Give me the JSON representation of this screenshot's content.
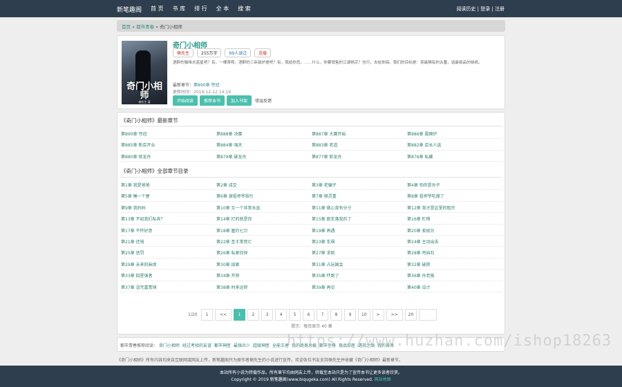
{
  "header": {
    "logo": "新笔趣阁",
    "nav": [
      "首 页",
      "书 库",
      "排 行",
      "全 本",
      "搜 索"
    ],
    "user": "阅读历史 | 登录 | 注册"
  },
  "breadcrumb": {
    "home": "首页",
    "category": "都市青春",
    "current": "奇门小相师",
    "sep": "»"
  },
  "book": {
    "title": "奇门小相师",
    "author": "楠先生",
    "words": "255万字",
    "readers": "69人读过",
    "status": "连载",
    "cover_title": "奇门小相师",
    "cover_sub": "楠先生 著",
    "intro": "酒醉的猫咪水蓝星吧？有，一棵茶呢。酒醉的三卧敌炉是吧？有，我给你您。……什么，你要销售的江湖杨宗？也行，去给你搞。我们的目标是：卖最稀有的古董，追最极品的妹纸。",
    "latest_label": "最新章节：",
    "latest_chapter": "第890章 夺冠",
    "updated_label": "更新时间：",
    "updated": "2019-12-12 14:19",
    "buttons": [
      "开始阅读",
      "推荐本书",
      "加入书架"
    ],
    "feedback": "错误反馈"
  },
  "latest": {
    "title": "《奇门小相师》最新章节",
    "chapters": [
      "第890章 夺冠",
      "第888章 决赛",
      "第887章 大赛开始",
      "第886章 震狮炉",
      "第885章 新店开业",
      "第884章 强天",
      "第883章 老道",
      "第882章 店长人选",
      "第880章 修龙舟",
      "第879章 破龙舟",
      "第877章 斩龙舟",
      "第876章 私藏"
    ]
  },
  "catalog": {
    "title": "《奇门小相师》全部章节目录",
    "chapters": [
      "第1章 我是爸爸",
      "第2章 成交",
      "第3章 老骗子",
      "第4章 怕你是孙子",
      "第5章 睡一个屋",
      "第6章 谢祖师爷指引",
      "第7章 够灵重",
      "第8章 祖师爷吃撑了",
      "第9章 我妈妈",
      "第10章 又一个非常水盆",
      "第11章 做心我有分寸",
      "第12章 我才是这里的租宗",
      "第13章 不如我们私奔？",
      "第14章 打的就是你",
      "第15章 跑车落我的了",
      "第16章 盯梢",
      "第17章 不怀好意",
      "第18章 匿约七贝",
      "第19章 再遇",
      "第20章 卖砚台",
      "第21章 还钱",
      "第22章 圣王常死亡",
      "第23章 车祸",
      "第24章 主动出击",
      "第25章 惩罚",
      "第26章 私家侦探",
      "第27章 求助",
      "第28章 鸡血石",
      "第29章 未来的麻烦",
      "第30章 线索",
      "第31章 占玩国会",
      "第32章 破除",
      "第33章 四星强者",
      "第34章 开除",
      "第35章 吓跑了",
      "第36章 孙老板",
      "第37章 诅咒富青铜",
      "第38章 时来运转",
      "第39章 再见",
      "第40章 设计"
    ]
  },
  "pager": {
    "info": "1/20",
    "first": "1",
    "prev": "<<",
    "pages": [
      "1",
      "2",
      "3",
      "4",
      "5",
      "6",
      "7",
      "8",
      "9",
      "10"
    ],
    "next": ">",
    "next2": ">>",
    "last": "20",
    "hint": "提示：每页显示 40 章"
  },
  "recommend": {
    "label": "都市青春推荐阅读：",
    "books": [
      "奇门小相师",
      "经过考验的友谊",
      "都市神医",
      "最强兵少",
      "超级神医",
      "全能王者",
      "我的绝美总裁",
      "都市至尊",
      "极品狂医",
      "透视之眼",
      "我的首席"
    ]
  },
  "disclaimer": "《奇门小相师》所有内容均来自互联网或网友上传，新笔趣阁只为原作者楠先生的小说进行宣传。欢迎各位书友支持楠先生并收藏《奇门小相师》最新章节。",
  "footer": {
    "line1": "本站所有小说为转载作品，所有章节均由网友上传，转载至本站只是为了宣传本书让更多读者欣赏。",
    "line2": "Copyright © 2019 新笔趣阁(www.biqugeka.com) All Rights Reserved.",
    "sitemap": "网站地图"
  },
  "watermark": "https://www.huzhan.com/ishop18263"
}
